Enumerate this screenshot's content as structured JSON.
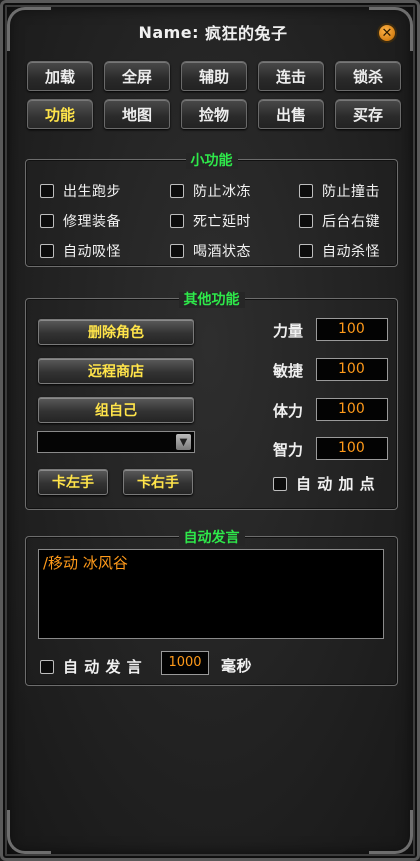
{
  "window": {
    "name_label": "Name:",
    "name_value": "疯狂的兔子",
    "close_icon": "close-icon"
  },
  "tabs_row1": [
    "加载",
    "全屏",
    "辅助",
    "连击",
    "锁杀"
  ],
  "tabs_row2": [
    "功能",
    "地图",
    "捡物",
    "出售",
    "买存"
  ],
  "active_tab": "功能",
  "small_features": {
    "title": "小功能",
    "options": [
      {
        "label": "出生跑步",
        "checked": false
      },
      {
        "label": "防止冰冻",
        "checked": false
      },
      {
        "label": "防止撞击",
        "checked": false
      },
      {
        "label": "修理装备",
        "checked": false
      },
      {
        "label": "死亡延时",
        "checked": false
      },
      {
        "label": "后台右键",
        "checked": false
      },
      {
        "label": "自动吸怪",
        "checked": false
      },
      {
        "label": "喝酒状态",
        "checked": false
      },
      {
        "label": "自动杀怪",
        "checked": false
      }
    ]
  },
  "other_features": {
    "title": "其他功能",
    "delete_role": "删除角色",
    "remote_shop": "远程商店",
    "group_self": "组自己",
    "dropdown_value": "",
    "left_hand": "卡左手",
    "right_hand": "卡右手",
    "stats": [
      {
        "label": "力量",
        "value": "100"
      },
      {
        "label": "敏捷",
        "value": "100"
      },
      {
        "label": "体力",
        "value": "100"
      },
      {
        "label": "智力",
        "value": "100"
      }
    ],
    "auto_points": {
      "label": "自 动 加 点",
      "checked": false
    }
  },
  "auto_speak": {
    "title": "自动发言",
    "message": "/移动 冰风谷",
    "enable_label": "自 动 发 言",
    "enabled": false,
    "interval": "1000",
    "unit": "毫秒"
  },
  "colors": {
    "accent_yellow": "#ffe44a",
    "group_title_green": "#2ee84a",
    "input_orange": "#ff9a1a"
  }
}
